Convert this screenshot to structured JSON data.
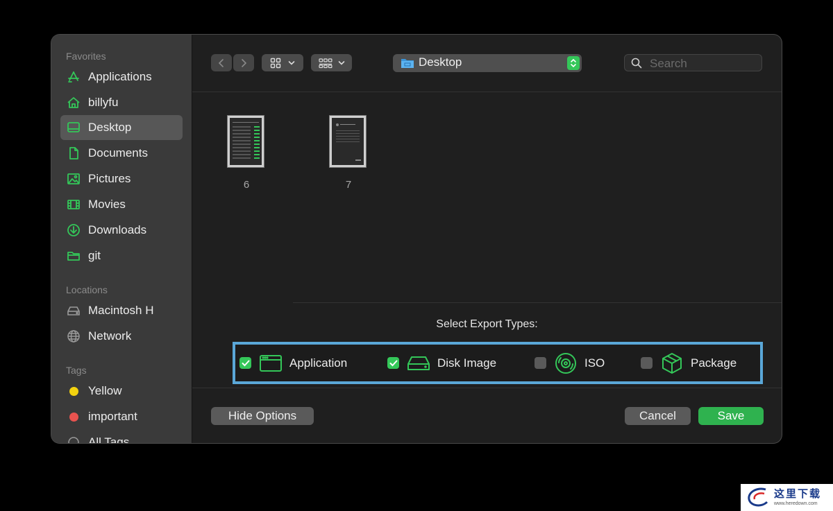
{
  "sidebar": {
    "favorites_title": "Favorites",
    "favorites": [
      {
        "label": "Applications",
        "icon": "applications-icon"
      },
      {
        "label": "billyfu",
        "icon": "home-icon"
      },
      {
        "label": "Desktop",
        "icon": "desktop-icon",
        "selected": true
      },
      {
        "label": "Documents",
        "icon": "document-icon"
      },
      {
        "label": "Pictures",
        "icon": "pictures-icon"
      },
      {
        "label": "Movies",
        "icon": "movies-icon"
      },
      {
        "label": "Downloads",
        "icon": "downloads-icon"
      },
      {
        "label": "git",
        "icon": "folder-icon"
      }
    ],
    "locations_title": "Locations",
    "locations": [
      {
        "label": "Macintosh H",
        "icon": "disk-icon"
      },
      {
        "label": "Network",
        "icon": "globe-icon"
      }
    ],
    "tags_title": "Tags",
    "tags": [
      {
        "label": "Yellow",
        "color": "#f2d20f"
      },
      {
        "label": "important",
        "color": "#e8534f"
      },
      {
        "label": "All Tags",
        "icon": "all-tags-icon"
      }
    ]
  },
  "toolbar": {
    "path": "Desktop",
    "search_placeholder": "Search"
  },
  "files": [
    {
      "name": "6"
    },
    {
      "name": "7"
    }
  ],
  "options": {
    "title": "Select Export Types:",
    "items": [
      {
        "label": "Application",
        "checked": true,
        "icon": "application-window-icon"
      },
      {
        "label": "Disk Image",
        "checked": true,
        "icon": "disk-image-icon"
      },
      {
        "label": "ISO",
        "checked": false,
        "icon": "iso-disc-icon"
      },
      {
        "label": "Package",
        "checked": false,
        "icon": "package-box-icon"
      }
    ]
  },
  "footer": {
    "hide_options": "Hide Options",
    "cancel": "Cancel",
    "save": "Save"
  },
  "colors": {
    "accent": "#34c759",
    "highlight_border": "#5aa7d8"
  }
}
